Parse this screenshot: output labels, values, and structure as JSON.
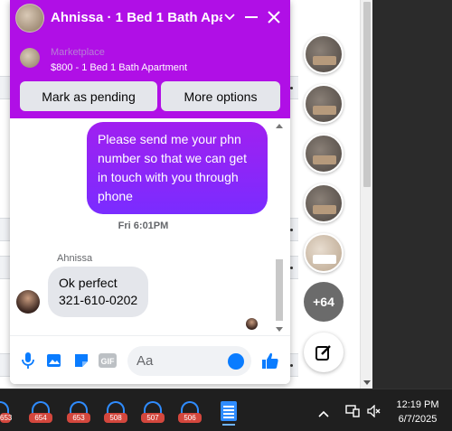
{
  "chat": {
    "title": "Ahnissa · 1 Bed 1 Bath Apa...",
    "marketplace_label": "Marketplace",
    "listing_title": "$800 - 1 Bed 1 Bath Apartment",
    "buttons": {
      "pending": "Mark as pending",
      "more": "More options"
    },
    "messages": {
      "outgoing": "Please send me your phn number so that we can get in touch with you through phone",
      "timestamp": "Fri 6:01PM",
      "sender_name": "Ahnissa",
      "incoming_line1": "Ok perfect",
      "incoming_line2": "321-610-0202"
    },
    "composer": {
      "placeholder": "Aa"
    },
    "accent_color": "#b00fe6"
  },
  "chat_heads": {
    "more_count": "+64"
  },
  "taskbar": {
    "apps": [
      {
        "badge": "653"
      },
      {
        "badge": "654"
      },
      {
        "badge": "653"
      },
      {
        "badge": "508"
      },
      {
        "badge": "507"
      },
      {
        "badge": "506"
      }
    ],
    "time": "12:19 PM",
    "date": "6/7/2025"
  }
}
